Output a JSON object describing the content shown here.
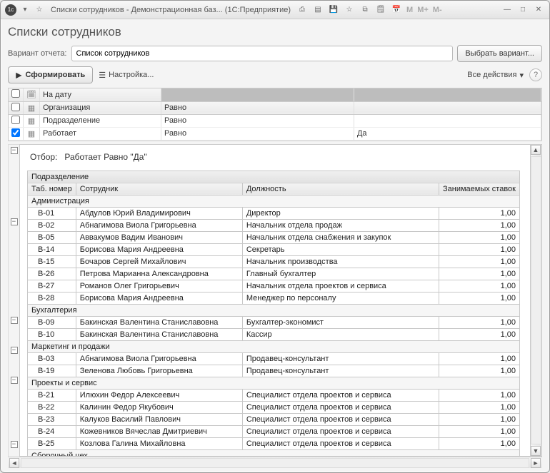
{
  "titlebar": {
    "app_icon_label": "1C",
    "title": "Списки сотрудников - Демонстрационная баз...  (1С:Предприятие)"
  },
  "page_title": "Списки сотрудников",
  "variant": {
    "label": "Вариант отчета:",
    "value": "Список сотрудников",
    "choose_btn": "Выбрать вариант..."
  },
  "toolbar": {
    "run": "Сформировать",
    "settings": "Настройка...",
    "all_actions": "Все действия"
  },
  "filter_header": {
    "on_date": "На дату"
  },
  "filters": [
    {
      "checked": false,
      "field": "Организация",
      "cond": "Равно",
      "value": ""
    },
    {
      "checked": false,
      "field": "Подразделение",
      "cond": "Равно",
      "value": ""
    },
    {
      "checked": true,
      "field": "Работает",
      "cond": "Равно",
      "value": "Да"
    }
  ],
  "report": {
    "filter_label": "Отбор:",
    "filter_text": "Работает Равно \"Да\"",
    "group_header_dept": "Подразделение",
    "columns": {
      "tab_no": "Таб. номер",
      "employee": "Сотрудник",
      "position": "Должность",
      "rates": "Занимаемых ставок"
    },
    "sections": [
      {
        "name": "Администрация",
        "rows": [
          {
            "no": "В-01",
            "emp": "Абдулов Юрий Владимирович",
            "pos": "Директор",
            "rate": "1,00"
          },
          {
            "no": "В-02",
            "emp": "Абнагимова Виола Григорьевна",
            "pos": "Начальник отдела продаж",
            "rate": "1,00"
          },
          {
            "no": "В-05",
            "emp": "Аввакумов Вадим Иванович",
            "pos": "Начальник отдела снабжения и закупок",
            "rate": "1,00"
          },
          {
            "no": "В-14",
            "emp": "Борисова Мария Андреевна",
            "pos": "Секретарь",
            "rate": "1,00"
          },
          {
            "no": "В-15",
            "emp": "Бочаров Сергей Михайлович",
            "pos": "Начальник производства",
            "rate": "1,00"
          },
          {
            "no": "В-26",
            "emp": "Петрова Марианна Александровна",
            "pos": "Главный бухгалтер",
            "rate": "1,00"
          },
          {
            "no": "В-27",
            "emp": "Романов Олег Григорьевич",
            "pos": "Начальник отдела проектов и сервиса",
            "rate": "1,00"
          },
          {
            "no": "В-28",
            "emp": "Борисова Мария Андреевна",
            "pos": "Менеджер по персоналу",
            "rate": "1,00"
          }
        ]
      },
      {
        "name": "Бухгалтерия",
        "rows": [
          {
            "no": "В-09",
            "emp": "Бакинская Валентина Станиславовна",
            "pos": "Бухгалтер-экономист",
            "rate": "1,00"
          },
          {
            "no": "В-10",
            "emp": "Бакинская Валентина Станиславовна",
            "pos": "Кассир",
            "rate": "1,00"
          }
        ]
      },
      {
        "name": "Маркетинг и продажи",
        "rows": [
          {
            "no": "В-03",
            "emp": "Абнагимова Виола Григорьевна",
            "pos": "Продавец-консультант",
            "rate": "1,00"
          },
          {
            "no": "В-19",
            "emp": "Зеленова Любовь Григорьевна",
            "pos": "Продавец-консультант",
            "rate": "1,00"
          }
        ]
      },
      {
        "name": "Проекты и сервис",
        "rows": [
          {
            "no": "В-21",
            "emp": "Илюхин Федор Алексеевич",
            "pos": "Специалист отдела проектов и сервиса",
            "rate": "1,00"
          },
          {
            "no": "В-22",
            "emp": "Калинин Федор Якубович",
            "pos": "Специалист отдела проектов и сервиса",
            "rate": "1,00"
          },
          {
            "no": "В-23",
            "emp": "Калуков Василий Павлович",
            "pos": "Специалист отдела проектов и сервиса",
            "rate": "1,00"
          },
          {
            "no": "В-24",
            "emp": "Кожевников Вячеслав Дмитриевич",
            "pos": "Специалист отдела проектов и сервиса",
            "rate": "1,00"
          },
          {
            "no": "В-25",
            "emp": "Козлова Галина Михайловна",
            "pos": "Специалист отдела проектов и сервиса",
            "rate": "1,00"
          }
        ]
      },
      {
        "name": "Сборочный цех",
        "rows": []
      }
    ]
  }
}
